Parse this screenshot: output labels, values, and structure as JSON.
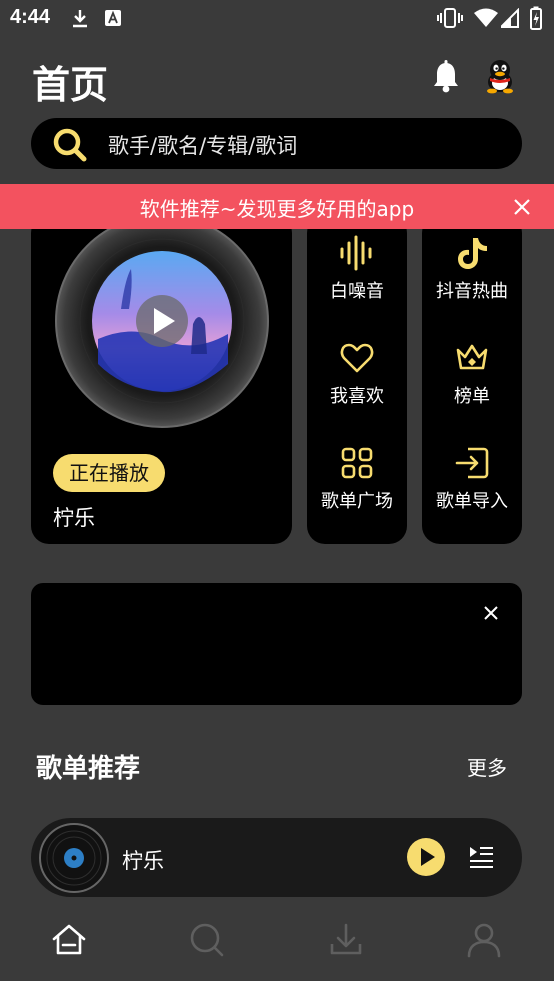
{
  "status_bar": {
    "time": "4:44"
  },
  "header": {
    "title": "首页"
  },
  "search": {
    "placeholder": "歌手/歌名/专辑/歌词"
  },
  "banner": {
    "text": "软件推荐~发现更多好用的app"
  },
  "player_card": {
    "badge": "正在播放",
    "song": "柠乐"
  },
  "grid": {
    "items": [
      {
        "label": "白噪音",
        "icon": "waveform-icon"
      },
      {
        "label": "抖音热曲",
        "icon": "tiktok-icon"
      },
      {
        "label": "我喜欢",
        "icon": "heart-icon"
      },
      {
        "label": "榜单",
        "icon": "crown-icon"
      },
      {
        "label": "歌单广场",
        "icon": "grid-icon"
      },
      {
        "label": "歌单导入",
        "icon": "import-icon"
      }
    ]
  },
  "section": {
    "title": "歌单推荐",
    "more": "更多"
  },
  "mini_player": {
    "title": "柠乐"
  },
  "bottom_nav": {
    "items": [
      "home-icon",
      "search-icon",
      "download-icon",
      "profile-icon"
    ]
  },
  "colors": {
    "accent": "#f7dc6f",
    "banner": "#f3525f",
    "background": "#3a3a3a"
  }
}
